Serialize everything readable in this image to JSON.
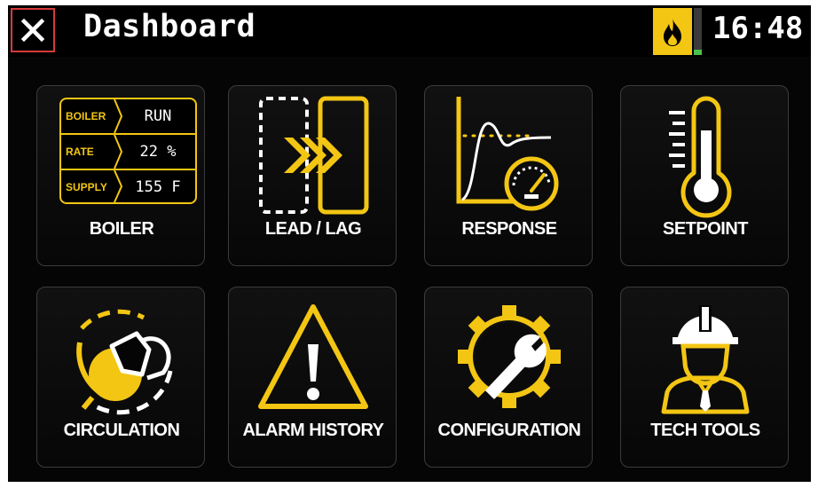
{
  "header": {
    "title": "Dashboard",
    "time": "16:48",
    "close_icon": "close-x-icon",
    "flame_icon": "flame-icon",
    "level_fraction": 0.12
  },
  "colors": {
    "accent": "#f3c613",
    "close_border": "#d63a3a",
    "bar_fill": "#4cc24c"
  },
  "boiler_status": {
    "rows": [
      {
        "label": "BOILER",
        "value": "RUN"
      },
      {
        "label": "RATE",
        "value": "22 %"
      },
      {
        "label": "SUPPLY",
        "value": "155 F"
      }
    ]
  },
  "tiles": [
    {
      "label": "BOILER",
      "icon": "boiler-status-table"
    },
    {
      "label": "LEAD / LAG",
      "icon": "lead-lag-icon"
    },
    {
      "label": "RESPONSE",
      "icon": "response-curve-icon"
    },
    {
      "label": "SETPOINT",
      "icon": "thermometer-icon"
    },
    {
      "label": "CIRCULATION",
      "icon": "pump-circulation-icon"
    },
    {
      "label": "ALARM HISTORY",
      "icon": "warning-icon"
    },
    {
      "label": "CONFIGURATION",
      "icon": "wrench-gear-icon"
    },
    {
      "label": "TECH TOOLS",
      "icon": "technician-icon"
    }
  ]
}
